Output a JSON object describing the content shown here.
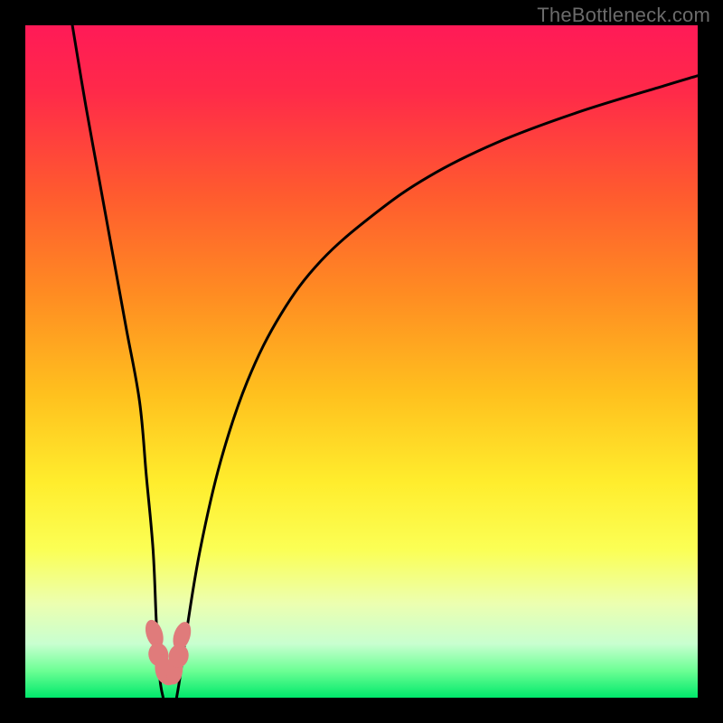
{
  "watermark": "TheBottleneck.com",
  "chart_data": {
    "type": "line",
    "title": "",
    "xlabel": "",
    "ylabel": "",
    "xlim": [
      0,
      100
    ],
    "ylim": [
      0,
      100
    ],
    "grid": false,
    "series": [
      {
        "name": "left-curve",
        "x": [
          7,
          9,
          11,
          13,
          15,
          17,
          18,
          19,
          19.5,
          20,
          20.5
        ],
        "y": [
          100,
          88,
          77,
          66,
          55,
          44,
          33,
          22,
          11,
          3,
          0
        ]
      },
      {
        "name": "right-curve",
        "x": [
          22.5,
          23,
          24,
          26,
          29,
          33,
          38,
          44,
          52,
          60,
          70,
          82,
          95,
          100
        ],
        "y": [
          0,
          3,
          10,
          22,
          35,
          47,
          57,
          65,
          72,
          77.5,
          82.5,
          87,
          91,
          92.5
        ]
      },
      {
        "name": "fit-zone-markers",
        "x": [
          19.2,
          19.8,
          20.5,
          21.3,
          22.2,
          22.8,
          23.3
        ],
        "y": [
          9.5,
          6.4,
          4.3,
          3.6,
          4.1,
          6.2,
          9.2
        ]
      }
    ],
    "gradient_stops": [
      {
        "offset": 0,
        "color": "#ff1a57"
      },
      {
        "offset": 10,
        "color": "#ff2a49"
      },
      {
        "offset": 25,
        "color": "#ff5a2f"
      },
      {
        "offset": 40,
        "color": "#ff8c22"
      },
      {
        "offset": 55,
        "color": "#ffc11e"
      },
      {
        "offset": 68,
        "color": "#ffed2d"
      },
      {
        "offset": 78,
        "color": "#fbff55"
      },
      {
        "offset": 86,
        "color": "#ecffb0"
      },
      {
        "offset": 92,
        "color": "#c8ffd0"
      },
      {
        "offset": 96,
        "color": "#6cff94"
      },
      {
        "offset": 100,
        "color": "#00e86b"
      }
    ],
    "marker_color": "#e07b7b",
    "curve_color": "#000000"
  }
}
